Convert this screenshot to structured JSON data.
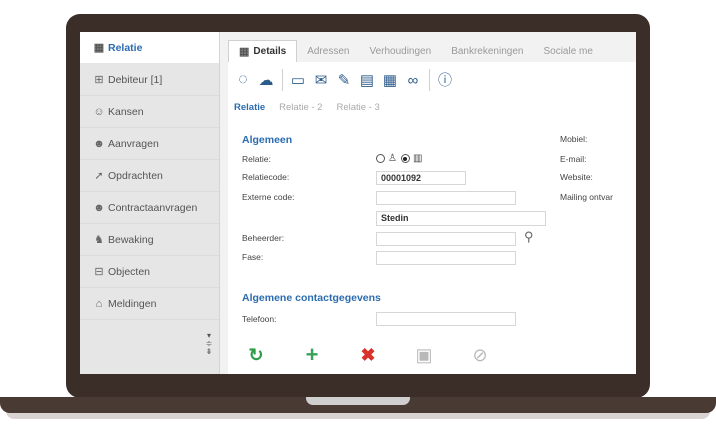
{
  "colors": {
    "accent": "#2b6cb0",
    "toolbar_icon": "#2c5b8a",
    "refresh": "#2e9e4a",
    "add": "#3aa15a",
    "delete": "#d9322b",
    "disabled": "#b9b9b9",
    "laptop": "#3b2e29"
  },
  "sidebar": {
    "items": [
      {
        "label": "Relatie",
        "icon": "relatie-icon"
      },
      {
        "label": "Debiteur [1]",
        "icon": "debiteur-icon"
      },
      {
        "label": "Kansen",
        "icon": "kansen-icon"
      },
      {
        "label": "Aanvragen",
        "icon": "aanvragen-icon"
      },
      {
        "label": "Opdrachten",
        "icon": "opdrachten-icon"
      },
      {
        "label": "Contractaanvragen",
        "icon": "contractaanvragen-icon"
      },
      {
        "label": "Bewaking",
        "icon": "bewaking-icon"
      },
      {
        "label": "Objecten",
        "icon": "objecten-icon"
      },
      {
        "label": "Meldingen",
        "icon": "meldingen-icon"
      }
    ]
  },
  "tabs": [
    {
      "label": "Details"
    },
    {
      "label": "Adressen"
    },
    {
      "label": "Verhoudingen"
    },
    {
      "label": "Bankrekeningen"
    },
    {
      "label": "Sociale me"
    }
  ],
  "toolbar": {
    "icons": [
      "spinner-icon",
      "cloud-search-icon",
      "calendar-add-icon",
      "mail-add-icon",
      "task-add-icon",
      "document-add-icon",
      "form-add-icon",
      "link-add-icon",
      "help-icon"
    ]
  },
  "subtabs": [
    {
      "label": "Relatie"
    },
    {
      "label": "Relatie - 2"
    },
    {
      "label": "Relatie - 3"
    }
  ],
  "form": {
    "section_general": "Algemeen",
    "relatie_label": "Relatie:",
    "relatie_selected": "organisatie",
    "relatiecode_label": "Relatiecode:",
    "relatiecode_value": "00001092",
    "externe_code_label": "Externe code:",
    "externe_code_value": "",
    "organisatie_value": "Stedin",
    "beheerder_label": "Beheerder:",
    "beheerder_value": "",
    "fase_label": "Fase:",
    "fase_value": "",
    "section_contact": "Algemene contactgegevens",
    "telefoon_label": "Telefoon:",
    "telefoon_value": ""
  },
  "right_col": {
    "mobiel_label": "Mobiel:",
    "email_label": "E-mail:",
    "website_label": "Website:",
    "mailing_label": "Mailing ontvar"
  },
  "bottom_actions": [
    {
      "name": "refresh-button",
      "icon": "refresh-icon",
      "glyph": "↻"
    },
    {
      "name": "add-button",
      "icon": "plus-icon",
      "glyph": "+"
    },
    {
      "name": "delete-button",
      "icon": "delete-icon",
      "glyph": "✖"
    },
    {
      "name": "save-button",
      "icon": "save-icon",
      "glyph": "▣"
    },
    {
      "name": "cancel-button",
      "icon": "cancel-icon",
      "glyph": "⊘"
    }
  ]
}
